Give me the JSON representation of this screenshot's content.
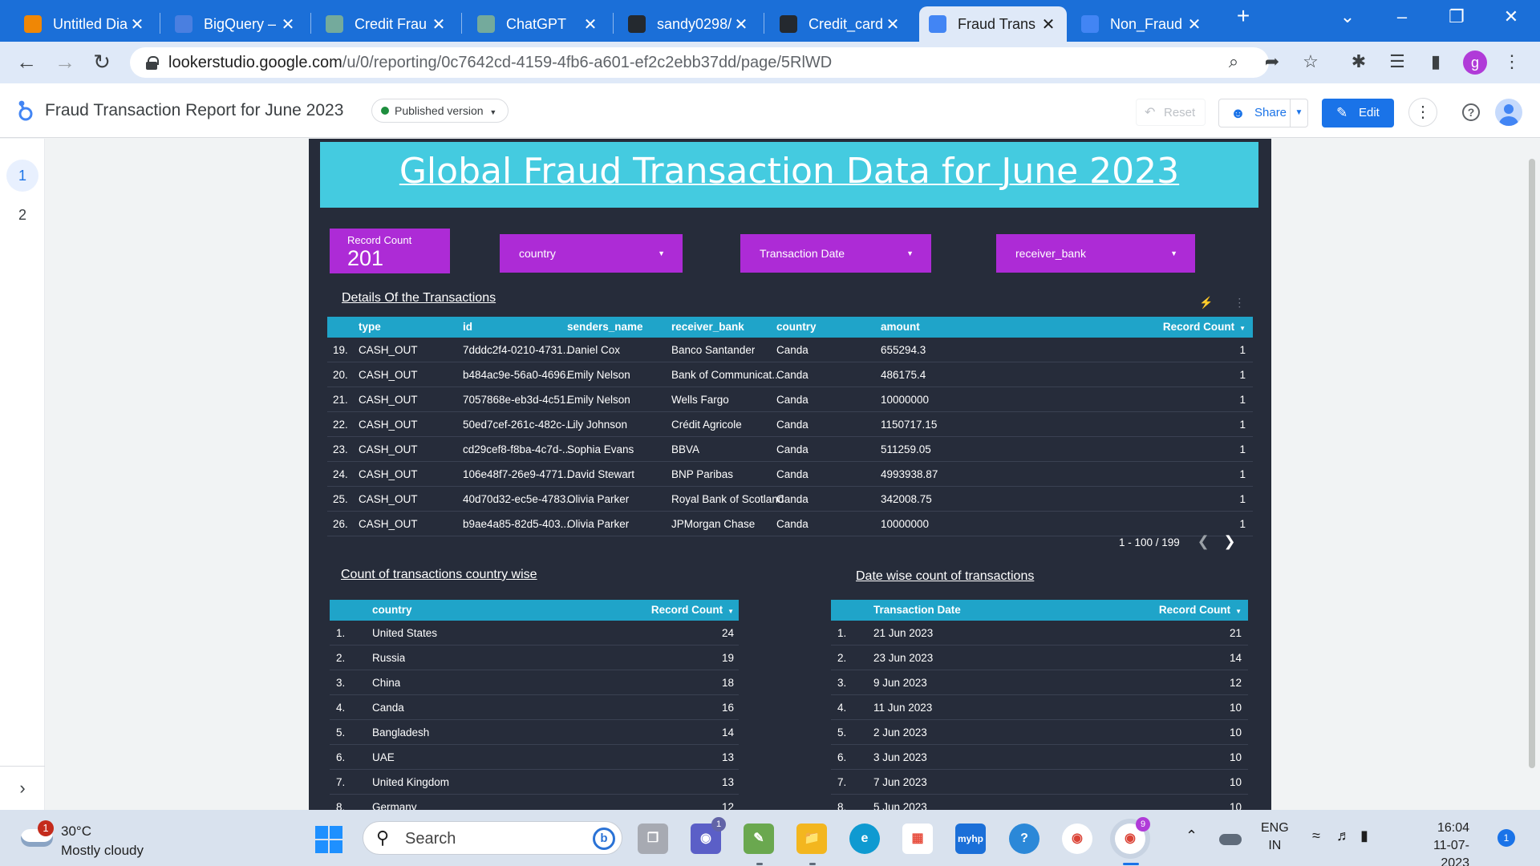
{
  "browser": {
    "tabs": [
      {
        "title": "Untitled Dia",
        "icon": "drawio-icon",
        "color": "#f08705"
      },
      {
        "title": "BigQuery –",
        "icon": "bigquery-icon",
        "color": "#4a7fe0"
      },
      {
        "title": "Credit Frau",
        "icon": "chatgpt-icon",
        "color": "#74aa9c"
      },
      {
        "title": "ChatGPT",
        "icon": "chatgpt-icon",
        "color": "#74aa9c"
      },
      {
        "title": "sandy0298/",
        "icon": "github-icon",
        "color": "#24292f"
      },
      {
        "title": "Credit_card",
        "icon": "github-icon",
        "color": "#24292f"
      },
      {
        "title": "Fraud Trans",
        "icon": "looker-studio-icon",
        "color": "#4285f4"
      },
      {
        "title": "Non_Fraud",
        "icon": "looker-studio-icon",
        "color": "#4285f4"
      }
    ],
    "active_tab_index": 6,
    "url_host": "lookerstudio.google.com",
    "url_path": "/u/0/reporting/0c7642cd-4159-4fb6-a601-ef2c2ebb37dd/page/5RlWD",
    "profile_initial": "g"
  },
  "looker": {
    "report_title": "Fraud Transaction Report for June 2023",
    "version_chip": "Published version",
    "reset_label": "Reset",
    "share_label": "Share",
    "edit_label": "Edit",
    "pages": [
      "1",
      "2"
    ]
  },
  "report": {
    "banner_title": "Global Fraud Transaction Data for June 2023",
    "scorecard": {
      "label": "Record Count",
      "value": "201"
    },
    "filters": {
      "country": "country",
      "date": "Transaction Date",
      "bank": "receiver_bank"
    },
    "details_title": "Details Of the Transactions",
    "details_table": {
      "headers": [
        "type",
        "id",
        "senders_name",
        "receiver_bank",
        "country",
        "amount",
        "Record Count"
      ],
      "rows": [
        [
          "19.",
          "CASH_OUT",
          "7dddc2f4-0210-4731...",
          "Daniel Cox",
          "Banco Santander",
          "Canda",
          "655294.3",
          "1"
        ],
        [
          "20.",
          "CASH_OUT",
          "b484ac9e-56a0-4696...",
          "Emily Nelson",
          "Bank of Communicat...",
          "Canda",
          "486175.4",
          "1"
        ],
        [
          "21.",
          "CASH_OUT",
          "7057868e-eb3d-4c51...",
          "Emily Nelson",
          "Wells Fargo",
          "Canda",
          "10000000",
          "1"
        ],
        [
          "22.",
          "CASH_OUT",
          "50ed7cef-261c-482c-...",
          "Lily Johnson",
          "Crédit Agricole",
          "Canda",
          "1150717.15",
          "1"
        ],
        [
          "23.",
          "CASH_OUT",
          "cd29cef8-f8ba-4c7d-...",
          "Sophia Evans",
          "BBVA",
          "Canda",
          "511259.05",
          "1"
        ],
        [
          "24.",
          "CASH_OUT",
          "106e48f7-26e9-4771...",
          "David Stewart",
          "BNP Paribas",
          "Canda",
          "4993938.87",
          "1"
        ],
        [
          "25.",
          "CASH_OUT",
          "40d70d32-ec5e-4783...",
          "Olivia Parker",
          "Royal Bank of Scotland",
          "Canda",
          "342008.75",
          "1"
        ],
        [
          "26.",
          "CASH_OUT",
          "b9ae4a85-82d5-403...",
          "Olivia Parker",
          "JPMorgan Chase",
          "Canda",
          "10000000",
          "1"
        ]
      ],
      "pager": "1 - 100 / 199"
    },
    "country_title": "Count of transactions country wise",
    "country_table": {
      "headers": [
        "country",
        "Record Count"
      ],
      "rows": [
        [
          "1.",
          "United States",
          "24"
        ],
        [
          "2.",
          "Russia",
          "19"
        ],
        [
          "3.",
          "China",
          "18"
        ],
        [
          "4.",
          "Canda",
          "16"
        ],
        [
          "5.",
          "Bangladesh",
          "14"
        ],
        [
          "6.",
          "UAE",
          "13"
        ],
        [
          "7.",
          "United Kingdom",
          "13"
        ],
        [
          "8.",
          "Germany",
          "12"
        ]
      ]
    },
    "date_title": "Date wise count of transactions",
    "date_table": {
      "headers": [
        "Transaction Date",
        "Record Count"
      ],
      "rows": [
        [
          "1.",
          "21 Jun 2023",
          "21"
        ],
        [
          "2.",
          "23 Jun 2023",
          "14"
        ],
        [
          "3.",
          "9 Jun 2023",
          "12"
        ],
        [
          "4.",
          "11 Jun 2023",
          "10"
        ],
        [
          "5.",
          "2 Jun 2023",
          "10"
        ],
        [
          "6.",
          "3 Jun 2023",
          "10"
        ],
        [
          "7.",
          "7 Jun 2023",
          "10"
        ],
        [
          "8.",
          "5 Jun 2023",
          "10"
        ]
      ]
    },
    "colors": {
      "background": "#262c3a",
      "banner": "#44cbe0",
      "accent": "#ad2bd6",
      "table_header": "#1fa4c9"
    }
  },
  "taskbar": {
    "weather_temp": "30°C",
    "weather_cond": "Mostly cloudy",
    "weather_badge": "1",
    "search_placeholder": "Search",
    "teams_badge": "1",
    "chrome_badge": "9",
    "mhp_label": "myhp",
    "lang_top": "ENG",
    "lang_bottom": "IN",
    "time": "16:04",
    "date": "11-07-2023",
    "notification_count": "1"
  }
}
